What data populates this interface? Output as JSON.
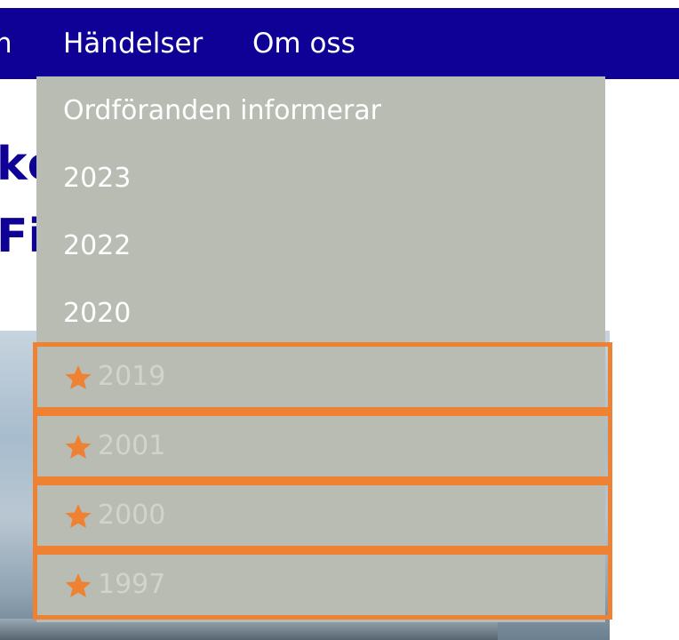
{
  "nav": {
    "partial_item": "n",
    "items": [
      {
        "label": "Händelser"
      },
      {
        "label": "Om oss"
      }
    ]
  },
  "hero": {
    "line1": "kc",
    "line2": "Fi"
  },
  "dropdown": {
    "items": [
      {
        "label": "Ordföranden informerar"
      },
      {
        "label": "2023"
      },
      {
        "label": "2022"
      },
      {
        "label": "2020"
      }
    ],
    "favorites": [
      {
        "label": "2019",
        "icon": "star-icon"
      },
      {
        "label": "2001",
        "icon": "star-icon"
      },
      {
        "label": "2000",
        "icon": "star-icon"
      },
      {
        "label": "1997",
        "icon": "star-icon"
      }
    ]
  },
  "colors": {
    "nav_background": "#0f0096",
    "dropdown_background": "#b8bcb2",
    "highlight_border": "#ef8232",
    "star": "#ef8232"
  }
}
